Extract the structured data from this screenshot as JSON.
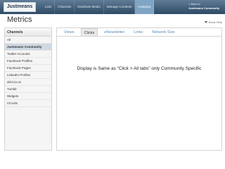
{
  "header": {
    "logo": "Justmeans",
    "nav": [
      "Lists",
      "Channels",
      "Distribute Media",
      "Manage Contents",
      "Analytics"
    ],
    "active_nav": "Analytics",
    "back_line1": "« Back to",
    "back_line2": "Justmeans Community"
  },
  "page": {
    "title": "Metrics",
    "help": "Show Help"
  },
  "sidebar": {
    "heading": "Channels",
    "items": [
      "All",
      "Justmeans Community",
      "Twitter Accounts",
      "Facebook Profiles",
      "Facebook Pages",
      "LinkedIn Profiles",
      "del.icio.us",
      "Tumblr",
      "Widgets",
      "Circuits"
    ],
    "active": "Justmeans Community"
  },
  "main": {
    "tabs": [
      "Views",
      "Clicks",
      "eNewsletter",
      "Links",
      "Network Size"
    ],
    "active_tab": "Clicks",
    "note": "Display is Same as “Click > All tabs”  only Community Specific"
  }
}
